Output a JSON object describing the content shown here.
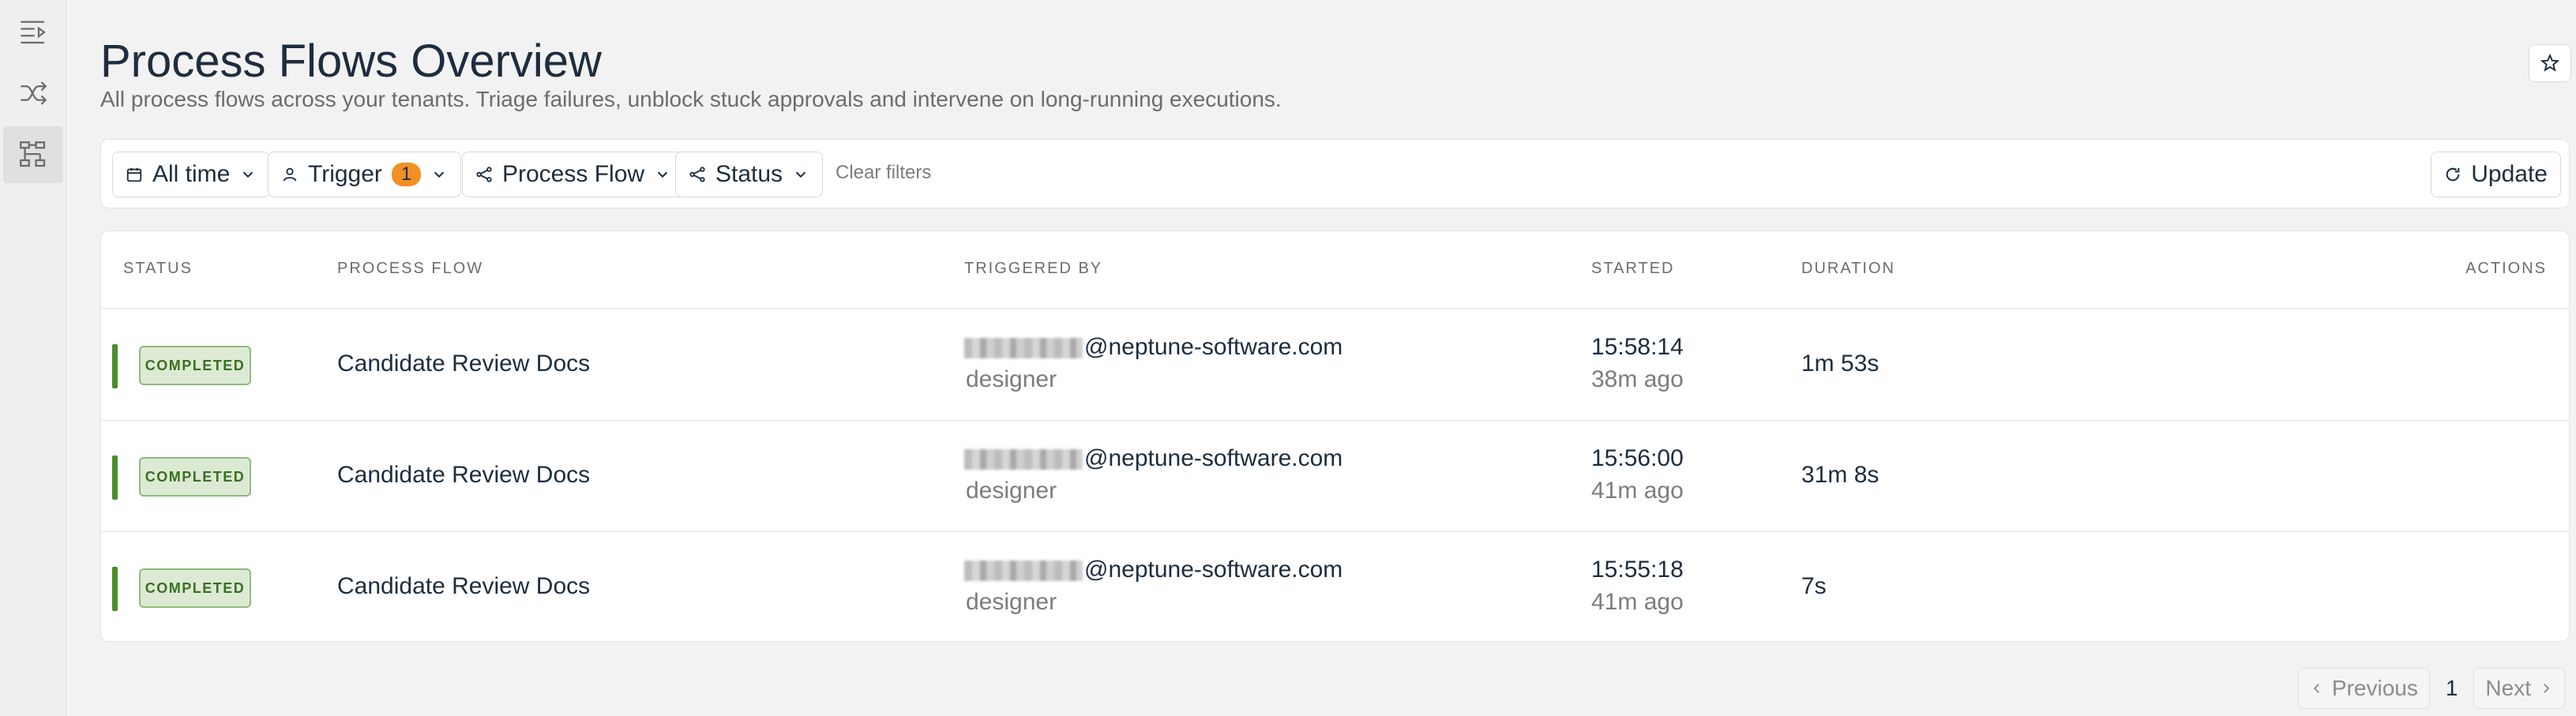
{
  "sidebar": {
    "items": [
      {
        "icon": "menu-collapse-icon"
      },
      {
        "icon": "shuffle-icon"
      },
      {
        "icon": "process-tree-icon",
        "active": true
      }
    ]
  },
  "header": {
    "title": "Process Flows Overview",
    "subtitle": "All process flows across your tenants. Triage failures, unblock stuck approvals and intervene on long-running executions."
  },
  "filters": {
    "time_label": "All time",
    "trigger_label": "Trigger",
    "trigger_count": "1",
    "process_flow_label": "Process Flow",
    "status_label": "Status",
    "clear_label": "Clear filters",
    "update_label": "Update"
  },
  "table": {
    "columns": {
      "status": "Status",
      "process_flow": "Process Flow",
      "triggered_by": "Triggered By",
      "started": "Started",
      "duration": "Duration",
      "actions": "Actions"
    },
    "rows": [
      {
        "status": "COMPLETED",
        "process_flow": "Candidate Review Docs",
        "email_domain": "@neptune-software.com",
        "role": "designer",
        "started_time": "15:58:14",
        "started_ago": "38m ago",
        "duration": "1m 53s"
      },
      {
        "status": "COMPLETED",
        "process_flow": "Candidate Review Docs",
        "email_domain": "@neptune-software.com",
        "role": "designer",
        "started_time": "15:56:00",
        "started_ago": "41m ago",
        "duration": "31m 8s"
      },
      {
        "status": "COMPLETED",
        "process_flow": "Candidate Review Docs",
        "email_domain": "@neptune-software.com",
        "role": "designer",
        "started_time": "15:55:18",
        "started_ago": "41m ago",
        "duration": "7s"
      }
    ]
  },
  "pagination": {
    "previous_label": "Previous",
    "current_page": "1",
    "next_label": "Next"
  },
  "colors": {
    "accent_badge": "#f39024",
    "status_completed": "#4a8c2a"
  }
}
